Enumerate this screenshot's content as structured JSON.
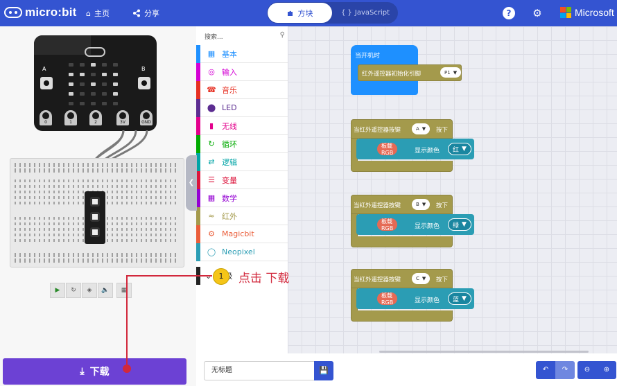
{
  "header": {
    "logo_text": "micro:bit",
    "home_label": "主页",
    "share_label": "分享",
    "blocks_tab_label": "方块",
    "js_tab_label": "JavaScript",
    "js_tab_icon": "{ }",
    "ms_label": "Microsoft",
    "accent": "#3454d1"
  },
  "simulator": {
    "pins": [
      "0",
      "1",
      "2",
      "3V",
      "GND"
    ],
    "button_a_label": "A",
    "button_b_label": "B",
    "led_on": [
      0,
      0,
      1,
      0,
      0,
      1,
      1,
      0,
      1,
      1,
      1,
      0,
      1,
      0,
      1,
      1,
      0,
      0,
      0,
      1,
      0,
      0,
      0,
      0,
      0
    ]
  },
  "download": {
    "label": "下载"
  },
  "toolbox": {
    "search_placeholder": "搜索...",
    "categories": [
      {
        "label": "基本",
        "color": "#1e90ff",
        "icon": "grid-icon"
      },
      {
        "label": "输入",
        "color": "#d400d4",
        "icon": "target-icon"
      },
      {
        "label": "音乐",
        "color": "#e63022",
        "icon": "headphones-icon"
      },
      {
        "label": "LED",
        "color": "#5c2d91",
        "icon": "toggle-icon"
      },
      {
        "label": "无线",
        "color": "#e3008c",
        "icon": "signal-icon"
      },
      {
        "label": "循环",
        "color": "#00aa00",
        "icon": "refresh-icon"
      },
      {
        "label": "逻辑",
        "color": "#00a4a6",
        "icon": "shuffle-icon"
      },
      {
        "label": "变量",
        "color": "#dc143c",
        "icon": "lines-icon"
      },
      {
        "label": "数学",
        "color": "#9400d3",
        "icon": "calculator-icon"
      },
      {
        "label": "红外",
        "color": "#a49a4c",
        "icon": "wifi-icon"
      },
      {
        "label": "Magicbit",
        "color": "#ea5e3a",
        "icon": "gear-icon"
      },
      {
        "label": "Neopixel",
        "color": "#2b9db4",
        "icon": "ring-icon"
      }
    ],
    "advanced_label": "高级"
  },
  "workspace": {
    "on_start": {
      "label": "当开机时",
      "init_label": "红外遥控器初始化引脚",
      "pin": "P1"
    },
    "handlers": [
      {
        "prefix": "当红外遥控器按键",
        "key": "A",
        "suffix": "按下",
        "pill": "板载RGB",
        "action": "显示颜色",
        "color": "红"
      },
      {
        "prefix": "当红外遥控器按键",
        "key": "B",
        "suffix": "按下",
        "pill": "板载RGB",
        "action": "显示颜色",
        "color": "绿"
      },
      {
        "prefix": "当红外遥控器按键",
        "key": "C",
        "suffix": "按下",
        "pill": "板载RGB",
        "action": "显示颜色",
        "color": "蓝"
      }
    ]
  },
  "bottom": {
    "project_name": "无标题"
  },
  "annotation": {
    "step": "1",
    "text": "点击 下载"
  }
}
